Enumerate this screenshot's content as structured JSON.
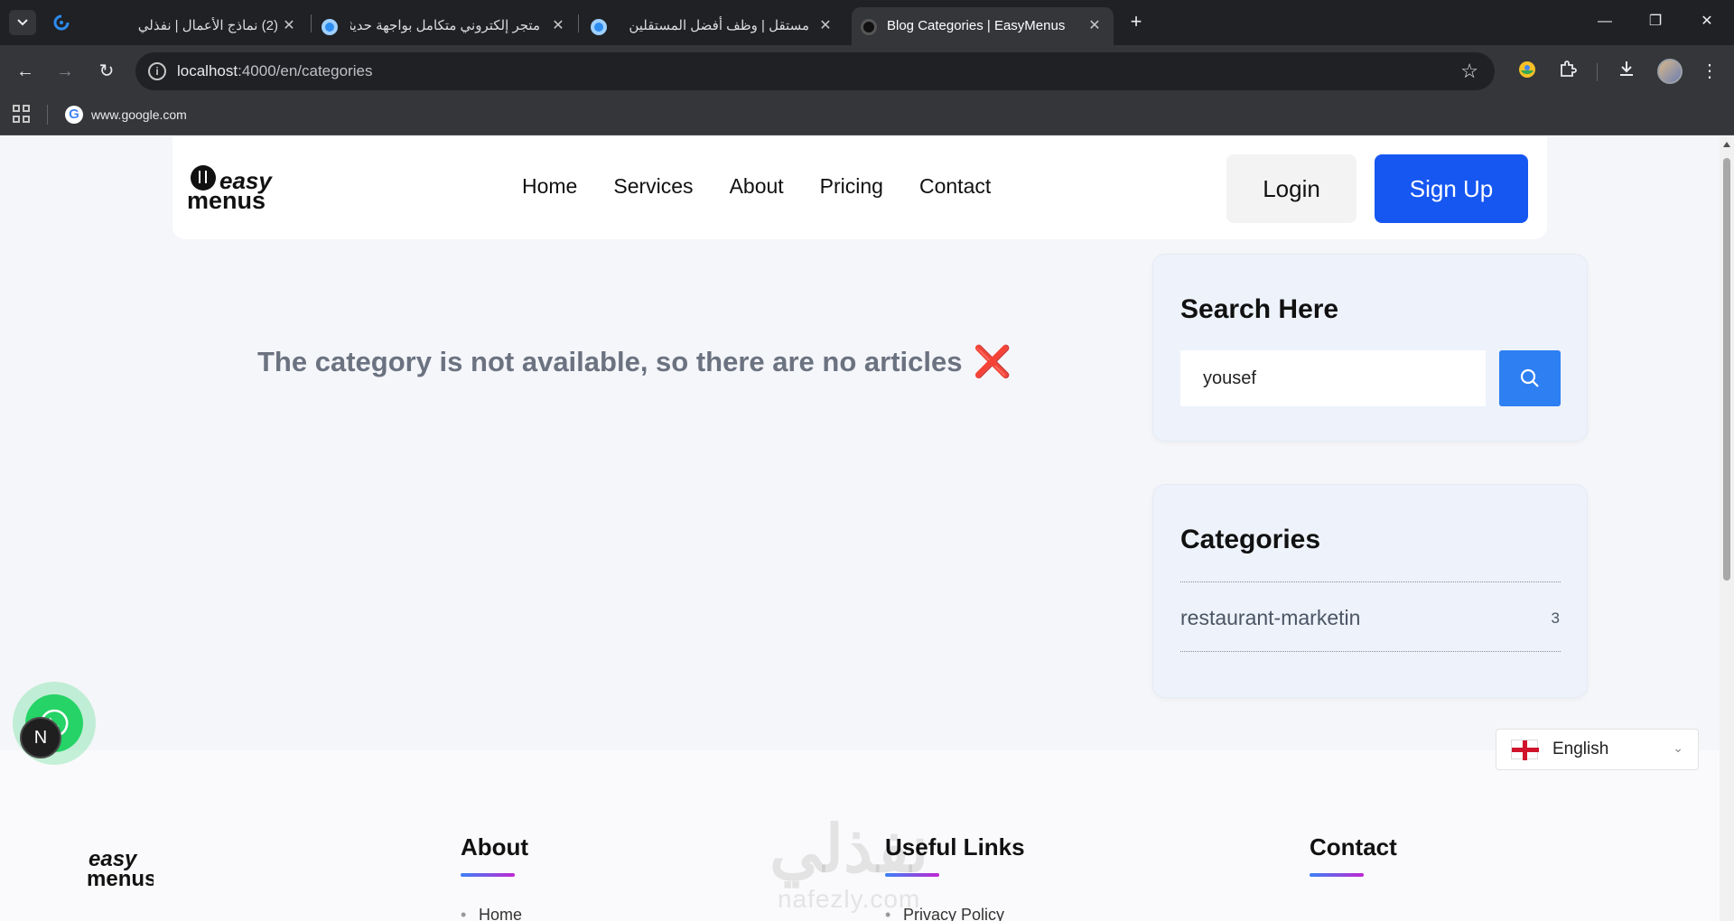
{
  "browser": {
    "tabs": [
      {
        "title": "(2) نماذج الأعمال | نفذلي",
        "active": false
      },
      {
        "title": "متجر إلكتروني متكامل بواجهة حديثة",
        "active": false
      },
      {
        "title": "مستقل | وظف أفضل المستقلين",
        "active": false
      },
      {
        "title": "Blog Categories | EasyMenus",
        "active": true
      }
    ],
    "url_host": "localhost",
    "url_path": ":4000/en/categories",
    "bookmark": "www.google.com"
  },
  "header": {
    "nav": [
      "Home",
      "Services",
      "About",
      "Pricing",
      "Contact"
    ],
    "login_label": "Login",
    "signup_label": "Sign Up",
    "logo_top": "easy",
    "logo_bottom": "menus"
  },
  "main": {
    "empty_message": "The category is not available, so there are no articles",
    "empty_icon": "❌"
  },
  "sidebar": {
    "search_title": "Search Here",
    "search_value": "yousef",
    "categories_title": "Categories",
    "categories": [
      {
        "name": "restaurant-marketin",
        "count": "3"
      }
    ]
  },
  "footer": {
    "about_title": "About",
    "links_title": "Useful Links",
    "contact_title": "Contact",
    "about_link": "Home",
    "useful_link": "Privacy Policy",
    "watermark_ar": "نفذلي",
    "watermark_en": "nafezly.com",
    "badge": "N",
    "language": "English"
  },
  "colors": {
    "primary": "#1657f2",
    "search_button": "#2d7ff2",
    "error_mark": "#ea3b5b",
    "whatsapp": "#25d366"
  }
}
